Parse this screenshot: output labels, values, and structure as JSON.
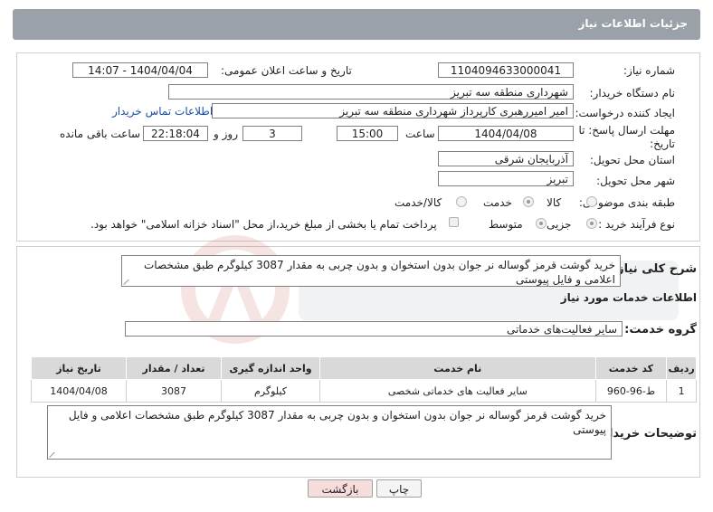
{
  "header": {
    "title": "جزئیات اطلاعات نیاز"
  },
  "form": {
    "need_number_label": "شماره نیاز:",
    "need_number": "1104094633000041",
    "announce_label": "تاریخ و ساعت اعلان عمومی:",
    "announce_value": "1404/04/04 - 14:07",
    "buyer_org_label": "نام دستگاه خریدار:",
    "buyer_org": "شهرداری منطقه سه تبریز",
    "creator_label": "ایجاد کننده درخواست:",
    "creator": "امیر امیررهبری کارپرداز شهرداری منطقه سه تبریز",
    "contact_link": "اطلاعات تماس خریدار",
    "deadline_label": "مهلت ارسال پاسخ: تا تاریخ:",
    "deadline_date": "1404/04/08",
    "time_label": "ساعت",
    "deadline_time": "15:00",
    "days_value": "3",
    "days_label": "روز و",
    "remaining_time": "22:18:04",
    "remaining_label": "ساعت باقی مانده",
    "province_label": "استان محل تحویل:",
    "province": "آذربایجان شرقی",
    "city_label": "شهر محل تحویل:",
    "city": "تبریز",
    "category_label": "طبقه بندی موضوعی:",
    "category_options": [
      "کالا",
      "خدمت",
      "کالا/خدمت"
    ],
    "category_selected": "خدمت",
    "process_label": "نوع فرآیند خرید :",
    "process_options": [
      "جزیی",
      "متوسط"
    ],
    "process_selected": "جزیی",
    "treasury_text": "پرداخت تمام یا بخشی از مبلغ خرید،از محل \"اسناد خزانه اسلامی\" خواهد بود."
  },
  "summary": {
    "label": "شرح کلی نیاز:",
    "text": "خرید گوشت قرمز گوساله نر جوان بدون استخوان و بدون چربی به مقدار 3087 کیلوگرم طبق مشخصات اعلامی و فایل پیوستی"
  },
  "services": {
    "section_title": "اطلاعات خدمات مورد نیاز",
    "group_label": "گروه خدمت:",
    "group_value": "سایر فعالیت‌های خدماتی",
    "columns": [
      "ردیف",
      "کد خدمت",
      "نام خدمت",
      "واحد اندازه گیری",
      "تعداد / مقدار",
      "تاریخ نیاز"
    ],
    "rows": [
      [
        "1",
        "ط-96-960",
        "سایر فعالیت های خدماتی شخصی",
        "کیلوگرم",
        "3087",
        "1404/04/08"
      ]
    ]
  },
  "buyer_notes": {
    "label": "توضیحات خریدار:",
    "text": "خرید گوشت قرمز گوساله نر جوان بدون استخوان و بدون چربی به مقدار 3087 کیلوگرم طبق مشخصات اعلامی و فایل پیوستی"
  },
  "buttons": {
    "print": "چاپ",
    "back": "بازگشت"
  },
  "colors": {
    "header": "#9aa1a8",
    "link": "#1a4fa8",
    "back_button": "#f7dcdc",
    "print_button": "#f4f4f4",
    "watermark": "#c0392b"
  }
}
